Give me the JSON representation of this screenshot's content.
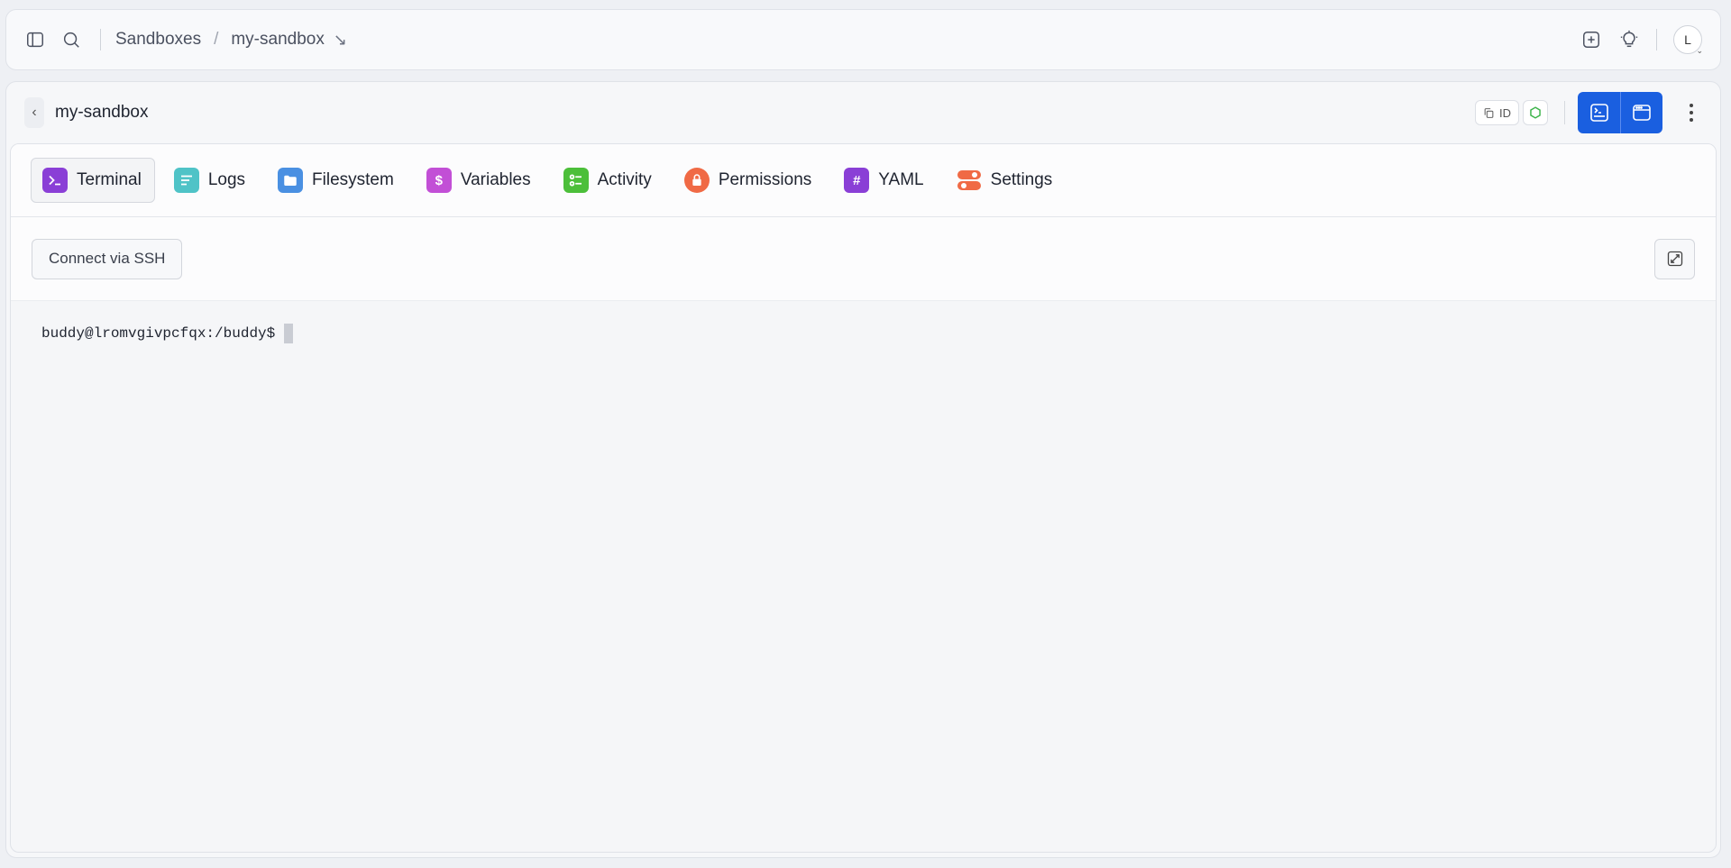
{
  "breadcrumb": {
    "root": "Sandboxes",
    "separator": "/",
    "current": "my-sandbox",
    "arrow": "↘"
  },
  "user": {
    "initial": "L"
  },
  "header": {
    "title": "my-sandbox",
    "id_chip": "ID"
  },
  "tabs": [
    {
      "label": "Terminal",
      "icon": "terminal-icon",
      "color": "#8a3fd6"
    },
    {
      "label": "Logs",
      "icon": "logs-icon",
      "color": "#4fc3c7"
    },
    {
      "label": "Filesystem",
      "icon": "folder-icon",
      "color": "#4a90e2"
    },
    {
      "label": "Variables",
      "icon": "dollar-icon",
      "color": "#c24fd6"
    },
    {
      "label": "Activity",
      "icon": "activity-icon",
      "color": "#4cbf3a"
    },
    {
      "label": "Permissions",
      "icon": "lock-icon",
      "color": "#f06a45"
    },
    {
      "label": "YAML",
      "icon": "hash-icon",
      "color": "#8a3fd6"
    },
    {
      "label": "Settings",
      "icon": "toggles-icon",
      "color": "#f06a45"
    }
  ],
  "toolbar": {
    "ssh_label": "Connect via SSH"
  },
  "terminal": {
    "prompt": "buddy@lromvgivpcfqx:/buddy$"
  },
  "colors": {
    "accent": "#1a5fe0",
    "status_green": "#3cb34a"
  }
}
